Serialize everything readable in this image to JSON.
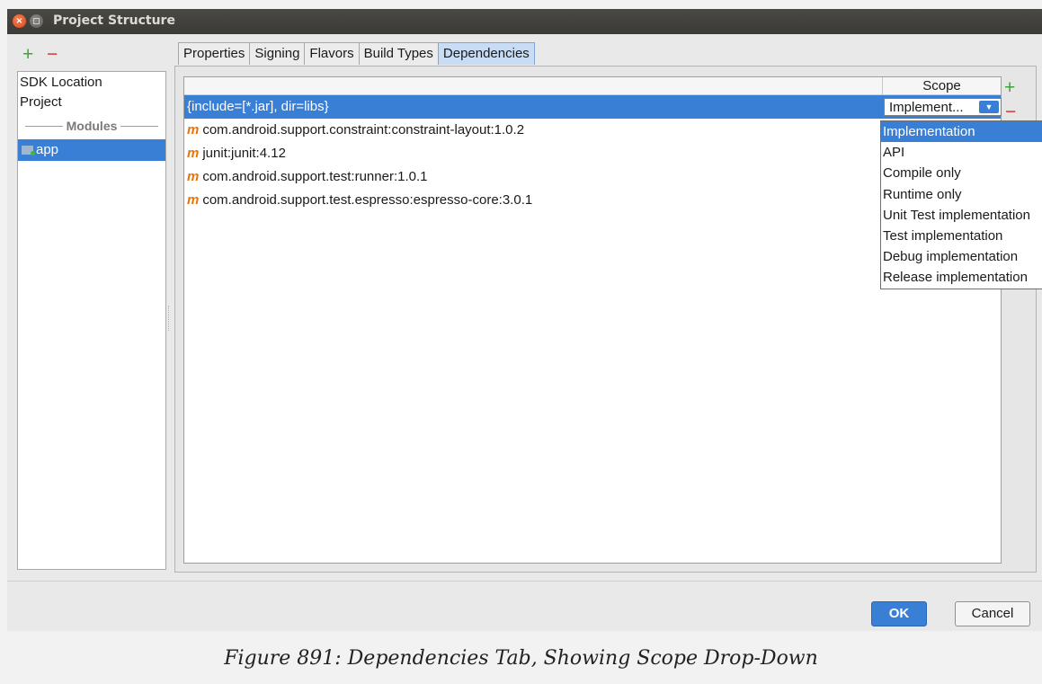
{
  "window": {
    "title": "Project Structure",
    "close_glyph": "×"
  },
  "sidebar": {
    "add_icon": "+",
    "remove_icon": "−",
    "items": [
      "SDK Location",
      "Project"
    ],
    "section_label": "Modules",
    "modules": [
      {
        "label": "app",
        "icon": "module-folder-icon"
      }
    ]
  },
  "tabs": [
    {
      "label": "Properties",
      "active": false
    },
    {
      "label": "Signing",
      "active": false
    },
    {
      "label": "Flavors",
      "active": false
    },
    {
      "label": "Build Types",
      "active": false
    },
    {
      "label": "Dependencies",
      "active": true
    }
  ],
  "dependencies": {
    "columns": {
      "name": "",
      "scope": "Scope"
    },
    "rows": [
      {
        "name": "{include=[*.jar], dir=libs}",
        "icon": "",
        "scope": "Implement...",
        "selected": true
      },
      {
        "name": "com.android.support.constraint:constraint-layout:1.0.2",
        "icon": "m",
        "scope": "",
        "selected": false
      },
      {
        "name": "junit:junit:4.12",
        "icon": "m",
        "scope": "",
        "selected": false
      },
      {
        "name": "com.android.support.test:runner:1.0.1",
        "icon": "m",
        "scope": "",
        "selected": false
      },
      {
        "name": "com.android.support.test.espresso:espresso-core:3.0.1",
        "icon": "m",
        "scope": "",
        "selected": false
      }
    ],
    "scope_arrow": "▼",
    "add_icon": "+",
    "remove_icon": "−"
  },
  "scope_options": [
    "Implementation",
    "API",
    "Compile only",
    "Runtime only",
    "Unit Test implementation",
    "Test implementation",
    "Debug implementation",
    "Release implementation"
  ],
  "scope_selected_index": 0,
  "buttons": {
    "ok": "OK",
    "cancel": "Cancel"
  },
  "caption": "Figure 891: Dependencies Tab, Showing Scope Drop-Down",
  "colors": {
    "selection": "#3a7fd6",
    "add": "#3aa53a",
    "remove": "#d13a3a",
    "maven_icon": "#e8740c"
  }
}
